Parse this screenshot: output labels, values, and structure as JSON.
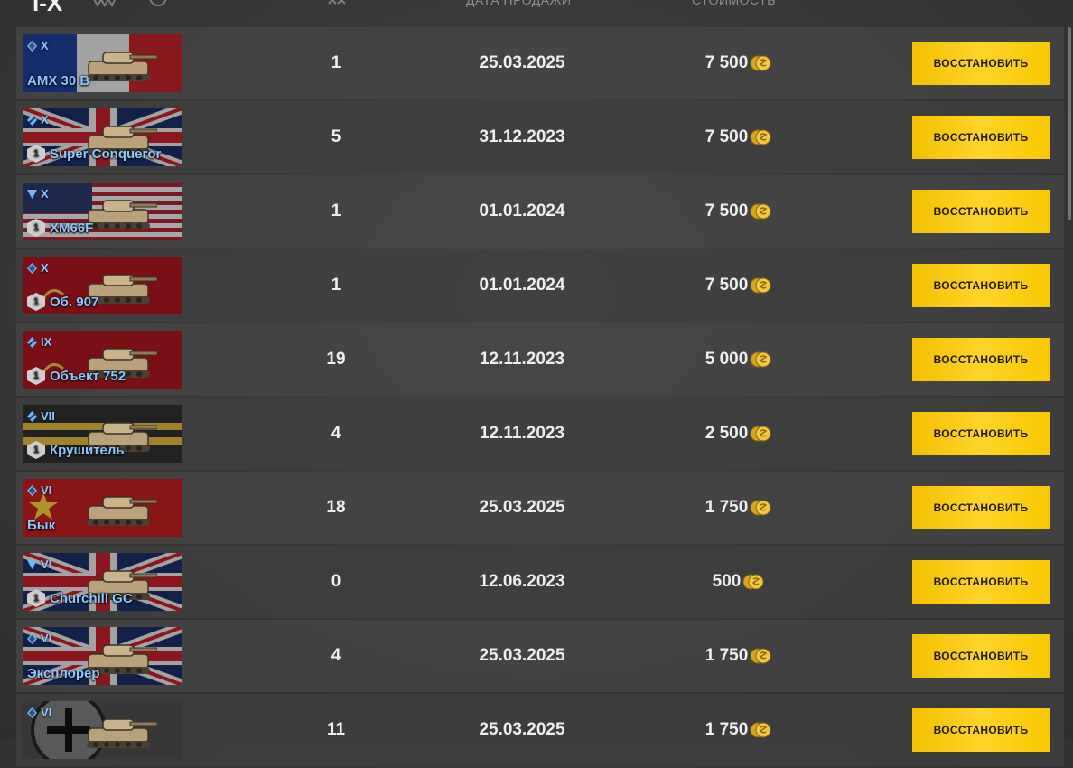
{
  "header": {
    "tier_label": "I-X",
    "col_date": "ДАТА ПРОДАЖИ",
    "col_price": "СТОИМОСТЬ"
  },
  "vehicles": [
    {
      "tier": "X",
      "name": "AMX 30 B",
      "rank": "",
      "battles": "1",
      "date": "25.03.2025",
      "price": "7 500",
      "nation": "france",
      "class": "medium",
      "button": "ВОССТАНОВИТЬ"
    },
    {
      "tier": "X",
      "name": "Super Conqueror",
      "rank": "1",
      "battles": "5",
      "date": "31.12.2023",
      "price": "7 500",
      "nation": "uk",
      "class": "heavy",
      "button": "ВОССТАНОВИТЬ"
    },
    {
      "tier": "X",
      "name": "XM66F",
      "rank": "1",
      "battles": "1",
      "date": "01.01.2024",
      "price": "7 500",
      "nation": "usa",
      "class": "td",
      "button": "ВОССТАНОВИТЬ"
    },
    {
      "tier": "X",
      "name": "Об. 907",
      "rank": "1",
      "battles": "1",
      "date": "01.01.2024",
      "price": "7 500",
      "nation": "ussr",
      "class": "medium",
      "button": "ВОССТАНОВИТЬ"
    },
    {
      "tier": "IX",
      "name": "Объект 752",
      "rank": "1",
      "battles": "19",
      "date": "12.11.2023",
      "price": "5 000",
      "nation": "ussr",
      "class": "heavy",
      "button": "ВОССТАНОВИТЬ"
    },
    {
      "tier": "VII",
      "name": "Крушитель",
      "rank": "1",
      "battles": "4",
      "date": "12.11.2023",
      "price": "2 500",
      "nation": "european",
      "class": "heavy",
      "button": "ВОССТАНОВИТЬ"
    },
    {
      "tier": "VI",
      "name": "Бык",
      "rank": "",
      "battles": "18",
      "date": "25.03.2025",
      "price": "1 750",
      "nation": "china",
      "class": "medium",
      "button": "ВОССТАНОВИТЬ"
    },
    {
      "tier": "VI",
      "name": "Churchill GC",
      "rank": "1",
      "battles": "0",
      "date": "12.06.2023",
      "price": "500",
      "nation": "uk",
      "class": "td",
      "button": "ВОССТАНОВИТЬ"
    },
    {
      "tier": "VI",
      "name": "Эксплорер",
      "rank": "",
      "battles": "4",
      "date": "25.03.2025",
      "price": "1 750",
      "nation": "uk",
      "class": "medium",
      "button": "ВОССТАНОВИТЬ"
    },
    {
      "tier": "VI",
      "name": "",
      "rank": "",
      "battles": "11",
      "date": "25.03.2025",
      "price": "1 750",
      "nation": "germany",
      "class": "medium",
      "button": "ВОССТАНОВИТЬ"
    }
  ],
  "colors": {
    "button": "#ffd42a",
    "name_text": "#8fc7ff",
    "coin": "#e8b92e"
  }
}
